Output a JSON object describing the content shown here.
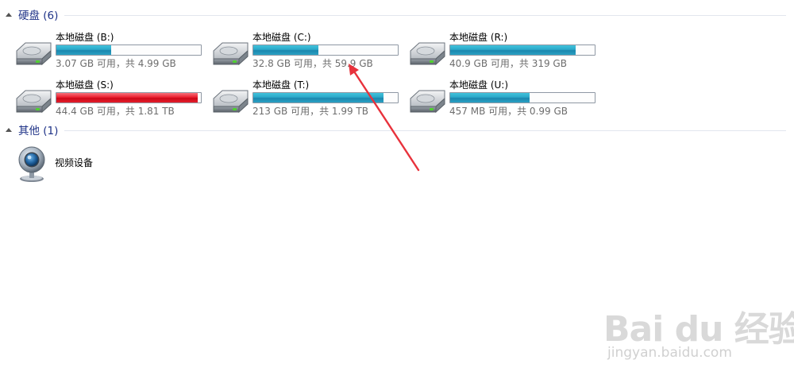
{
  "groups": {
    "hard_disks": {
      "title": "硬盘 (6)"
    },
    "other": {
      "title": "其他 (1)"
    }
  },
  "drives": [
    {
      "name": "本地磁盘 (B:)",
      "info": "3.07 GB 可用，共 4.99 GB",
      "used_fraction": 0.38,
      "color": "#2ba7c8"
    },
    {
      "name": "本地磁盘 (C:)",
      "info": "32.8 GB 可用，共 59.9 GB",
      "used_fraction": 0.45,
      "color": "#2ba7c8"
    },
    {
      "name": "本地磁盘 (R:)",
      "info": "40.9 GB 可用，共 319 GB",
      "used_fraction": 0.87,
      "color": "#2ba7c8"
    },
    {
      "name": "本地磁盘 (S:)",
      "info": "44.4 GB 可用，共 1.81 TB",
      "used_fraction": 0.98,
      "color": "#cc0716"
    },
    {
      "name": "本地磁盘 (T:)",
      "info": "213 GB 可用，共 1.99 TB",
      "used_fraction": 0.9,
      "color": "#2ba7c8"
    },
    {
      "name": "本地磁盘 (U:)",
      "info": "457 MB 可用，共 0.99 GB",
      "used_fraction": 0.55,
      "color": "#2ba7c8"
    }
  ],
  "devices": [
    {
      "name": "视频设备",
      "icon": "webcam-icon"
    }
  ],
  "annotation": {
    "color": "#e8323c"
  },
  "watermark": {
    "logo_text": "Bai du 经验",
    "url": "jingyan.baidu.com"
  }
}
